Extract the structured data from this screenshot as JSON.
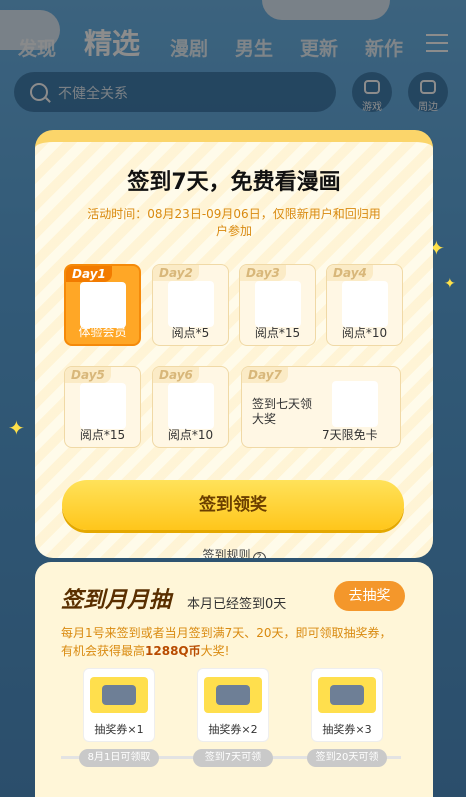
{
  "nav": {
    "tabs": [
      "发现",
      "精选",
      "漫剧",
      "男生",
      "更新",
      "新作"
    ],
    "active": "精选"
  },
  "search": {
    "placeholder": "不健全关系"
  },
  "side_buttons": [
    {
      "label": "游戏",
      "icon": "gamepad-icon"
    },
    {
      "label": "周边",
      "icon": "shopping-bag-icon"
    }
  ],
  "modal": {
    "title": "签到7天，免费看漫画",
    "subtitle": "活动时间：08月23日-09月06日，仅限新用户和回归用户参加",
    "days": [
      {
        "tag": "Day1",
        "reward": "体验会员",
        "active": true
      },
      {
        "tag": "Day2",
        "reward": "阅点*5"
      },
      {
        "tag": "Day3",
        "reward": "阅点*15"
      },
      {
        "tag": "Day4",
        "reward": "阅点*10"
      },
      {
        "tag": "Day5",
        "reward": "阅点*15"
      },
      {
        "tag": "Day6",
        "reward": "阅点*10"
      },
      {
        "tag": "Day7",
        "reward": "7天限免卡",
        "note": "签到七天领大奖"
      }
    ],
    "claim_button": "签到领奖",
    "rules_link": "签到规则"
  },
  "lottery": {
    "title": "签到月月抽",
    "status": "本月已经签到0天",
    "draw_button": "去抽奖",
    "desc_pre": "每月1号来签到或者当月签到满7天、20天，即可领取抽奖券，有机会获得最高",
    "desc_highlight": "1288Q币",
    "desc_post": "大奖!",
    "tickets": [
      "抽奖券×1",
      "抽奖券×2",
      "抽奖券×3"
    ],
    "milestones": [
      "8月1日可领取",
      "签到7天可领",
      "签到20天可领"
    ]
  },
  "colors": {
    "accent": "#ffa726",
    "button_yellow": "#ffc61b",
    "subtitle_orange": "#d98a10"
  }
}
